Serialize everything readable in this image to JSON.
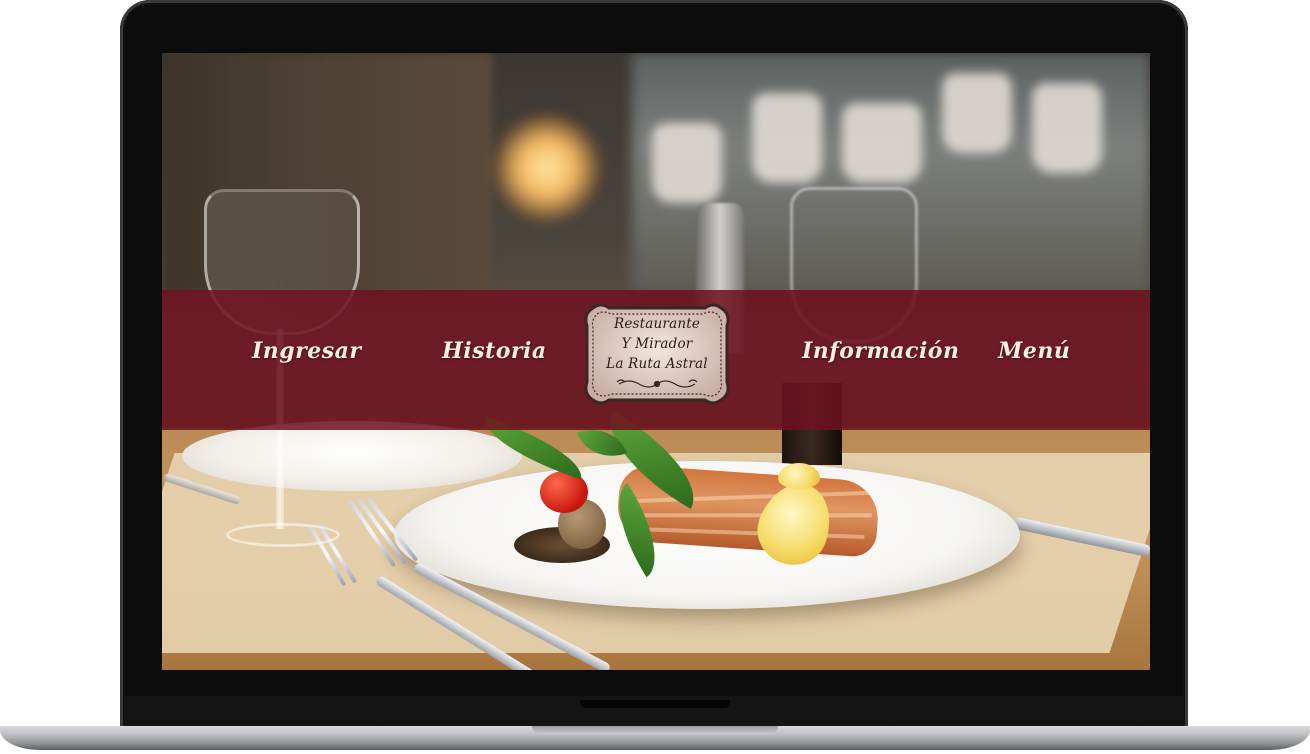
{
  "nav": {
    "items": [
      {
        "label": "Ingresar"
      },
      {
        "label": "Historia"
      },
      {
        "label": "Información"
      },
      {
        "label": "Menú"
      }
    ],
    "band_color": "#6f121e"
  },
  "logo": {
    "lines": [
      "Restaurante",
      "Y Mirador",
      "La Ruta Astral"
    ],
    "icon": "ornament-scroll-icon"
  },
  "hero": {
    "image": "restaurant-plate-salmon-photo"
  },
  "device": {
    "frame": "laptop"
  }
}
